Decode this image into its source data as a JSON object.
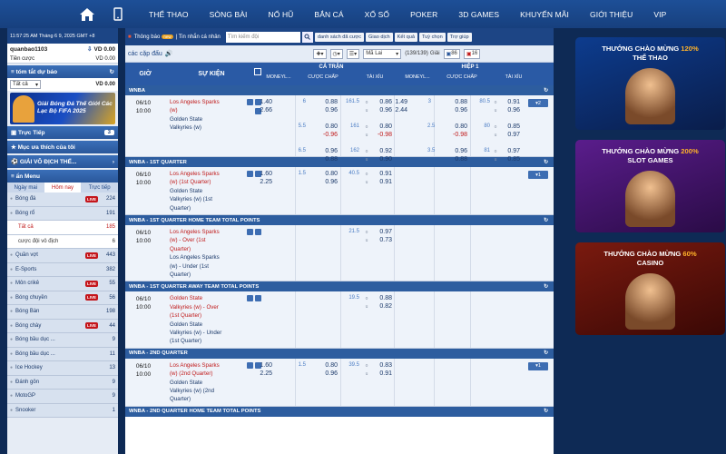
{
  "nav": {
    "items": [
      "THỂ THAO",
      "SÒNG BÀI",
      "NỔ HŨ",
      "BẮN CÁ",
      "XỔ SỐ",
      "POKER",
      "3D GAMES",
      "KHUYẾN MÃI",
      "GIỚI THIỆU",
      "VIP"
    ]
  },
  "left": {
    "time": "11:57:25 AM Tháng 6 9, 2025 GMT +8",
    "username": "quanbao1103",
    "username_balance": "VD 0.00",
    "credit_label": "Tiền cược",
    "credit_value": "VD 0.00",
    "summary_title": "tóm tắt dự báo",
    "summary_select": "Tất cả",
    "summary_value": "VD 0.00",
    "banner_text": "Giải Bóng Đá Thế Giới Các Lạc Bộ FIFA 2025",
    "live_label": "Trực Tiếp",
    "live_count": "3",
    "favorites_label": "Mục ưa thích của tôi",
    "league_label": "GIẢI VÔ ĐỊCH THẾ...",
    "menu_title": "ẩn Menu",
    "tabs": [
      "Ngày mai",
      "Hôm nay",
      "Trực tiếp"
    ],
    "live_badge": "LIVE",
    "sports": [
      {
        "name": "Bóng đá",
        "live": true,
        "count": "224"
      },
      {
        "name": "Bóng rổ",
        "live": false,
        "count": "191"
      },
      {
        "name": "Tất cả",
        "live": false,
        "count": "185",
        "sub": "sel"
      },
      {
        "name": "cược đội vô địch",
        "live": false,
        "count": "6",
        "sub": "plain"
      },
      {
        "name": "Quần vợt",
        "live": true,
        "count": "443"
      },
      {
        "name": "E-Sports",
        "live": false,
        "count": "382"
      },
      {
        "name": "Môn crikê",
        "live": true,
        "count": "55"
      },
      {
        "name": "Bóng chuyền",
        "live": true,
        "count": "56"
      },
      {
        "name": "Bóng Bàn",
        "live": false,
        "count": "198"
      },
      {
        "name": "Bóng chày",
        "live": true,
        "count": "44"
      },
      {
        "name": "Bóng bầu dục ...",
        "live": false,
        "count": "9"
      },
      {
        "name": "Bóng bầu dục ...",
        "live": false,
        "count": "11"
      },
      {
        "name": "Ice Hockey",
        "live": false,
        "count": "13"
      },
      {
        "name": "Đánh gôn",
        "live": false,
        "count": "9"
      },
      {
        "name": "MotoGP",
        "live": false,
        "count": "9"
      },
      {
        "name": "Snooker",
        "live": false,
        "count": "1"
      }
    ]
  },
  "toolbar": {
    "notice_label": "Thông báo",
    "notice_badge": "new",
    "personal_news": "Tin nhắn cá nhân",
    "search_placeholder": "Tìm kiếm đội",
    "buttons": [
      "danh sách đã cược",
      "Giao dịch",
      "Kết quả",
      "Tuỳ chọn",
      "Trợ giúp"
    ]
  },
  "filter": {
    "title": "các cặp đấu",
    "odds_type": "Mã Lai",
    "page": "(139/139)",
    "page_label": "Giải",
    "count1": "86",
    "count2": "16"
  },
  "table": {
    "headers": {
      "time": "GIỜ",
      "event": "SỰ KIỆN",
      "full": "CẢ TRẬN",
      "half": "HIỆP 1",
      "moneyline": "MONEYL...",
      "handicap": "CƯỢC CHẤP",
      "ou": "TÀI XỈU"
    },
    "sections": [
      {
        "title": "WNBA",
        "matches": [
          {
            "date": "06/10",
            "time": "10:00",
            "teams": [
              "Los Angeles Sparks",
              "(w)",
              "Golden State",
              "Valkyries (w)"
            ],
            "more": "2",
            "lines": [
              {
                "ml": "1.40",
                "hcl": "6",
                "hc1": "0.88",
                "oul": "161.5",
                "ou1": "0.86",
                "ml2": "1.49",
                "hcl2": "3",
                "hc2": "0.88",
                "oul2": "80.5",
                "ou2": "0.91"
              },
              {
                "ml": "2.66",
                "hcl": "",
                "hc1": "0.96",
                "oul": "",
                "ou1": "0.96",
                "ml2": "2.44",
                "hcl2": "",
                "hc2": "0.96",
                "oul2": "",
                "ou2": "0.96"
              },
              {
                "ml": "",
                "hcl": "5.5",
                "hc1": "0.80",
                "oul": "161",
                "ou1": "0.80",
                "ml2": "",
                "hcl2": "2.5",
                "hc2": "0.80",
                "oul2": "80",
                "ou2": "0.85"
              },
              {
                "ml": "",
                "hcl": "",
                "hc1": "-0.96",
                "oul": "",
                "ou1": "-0.98",
                "ml2": "",
                "hcl2": "",
                "hc2": "-0.98",
                "oul2": "",
                "ou2": "0.97"
              },
              {
                "ml": "",
                "hcl": "6.5",
                "hc1": "0.96",
                "oul": "162",
                "ou1": "0.92",
                "ml2": "",
                "hcl2": "3.5",
                "hc2": "0.96",
                "oul2": "81",
                "ou2": "0.97"
              },
              {
                "ml": "",
                "hcl": "",
                "hc1": "0.88",
                "oul": "",
                "ou1": "0.90",
                "ml2": "",
                "hcl2": "",
                "hc2": "0.88",
                "oul2": "",
                "ou2": "0.85"
              }
            ]
          }
        ]
      },
      {
        "title": "WNBA - 1ST QUARTER",
        "matches": [
          {
            "date": "06/10",
            "time": "10:00",
            "teams": [
              "Los Angeles Sparks",
              "(w) (1st Quarter)",
              "Golden State",
              "Valkyries (w) (1st",
              "Quarter)"
            ],
            "more": "1",
            "lines": [
              {
                "ml": "1.60",
                "hcl": "1.5",
                "hc1": "0.80",
                "oul": "40.5",
                "ou1": "0.91"
              },
              {
                "ml": "2.25",
                "hcl": "",
                "hc1": "0.96",
                "oul": "",
                "ou1": "0.91"
              }
            ]
          }
        ]
      },
      {
        "title": "WNBA - 1ST QUARTER HOME TEAM TOTAL POINTS",
        "matches": [
          {
            "date": "06/10",
            "time": "10:00",
            "teams": [
              "Los Angeles Sparks",
              "(w) - Over (1st",
              "Quarter)",
              "Los Angeles Sparks",
              "(w) - Under (1st",
              "Quarter)"
            ],
            "lines": [
              {
                "ml": "",
                "hcl": "",
                "hc1": "",
                "oul": "21.5",
                "ou1": "0.97"
              },
              {
                "ml": "",
                "hcl": "",
                "hc1": "",
                "oul": "",
                "ou1": "0.73"
              }
            ]
          }
        ]
      },
      {
        "title": "WNBA - 1ST QUARTER AWAY TEAM TOTAL POINTS",
        "matches": [
          {
            "date": "06/10",
            "time": "10:00",
            "teams": [
              "Golden State",
              "Valkyries (w) - Over",
              "(1st Quarter)",
              "Golden State",
              "Valkyries (w) - Under",
              "(1st Quarter)"
            ],
            "lines": [
              {
                "ml": "",
                "hcl": "",
                "hc1": "",
                "oul": "19.5",
                "ou1": "0.88"
              },
              {
                "ml": "",
                "hcl": "",
                "hc1": "",
                "oul": "",
                "ou1": "0.82"
              }
            ]
          }
        ]
      },
      {
        "title": "WNBA - 2ND QUARTER",
        "matches": [
          {
            "date": "06/10",
            "time": "10:00",
            "teams": [
              "Los Angeles Sparks",
              "(w) (2nd Quarter)",
              "Golden State",
              "Valkyries (w) (2nd",
              "Quarter)"
            ],
            "more": "1",
            "lines": [
              {
                "ml": "1.60",
                "hcl": "1.5",
                "hc1": "0.80",
                "oul": "39.5",
                "ou1": "0.83"
              },
              {
                "ml": "2.25",
                "hcl": "",
                "hc1": "0.96",
                "oul": "",
                "ou1": "0.91"
              }
            ]
          }
        ]
      },
      {
        "title": "WNBA - 2ND QUARTER HOME TEAM TOTAL POINTS",
        "matches": []
      }
    ]
  },
  "promos": [
    {
      "l1": "THƯỞNG CHÀO MỪNG ",
      "hl": "120%",
      "l2": "THỂ THAO",
      "c1": "#0d3c8e",
      "c2": "#0a1d4a"
    },
    {
      "l1": "THƯỞNG CHÀO MỪNG ",
      "hl": "200%",
      "l2": "SLOT GAMES",
      "c1": "#5a1d8c",
      "c2": "#2a0b46"
    },
    {
      "l1": "THƯỞNG CHÀO MỪNG ",
      "hl": "60%",
      "l2": "CASINO",
      "c1": "#7a1a0f",
      "c2": "#3a0805"
    }
  ]
}
